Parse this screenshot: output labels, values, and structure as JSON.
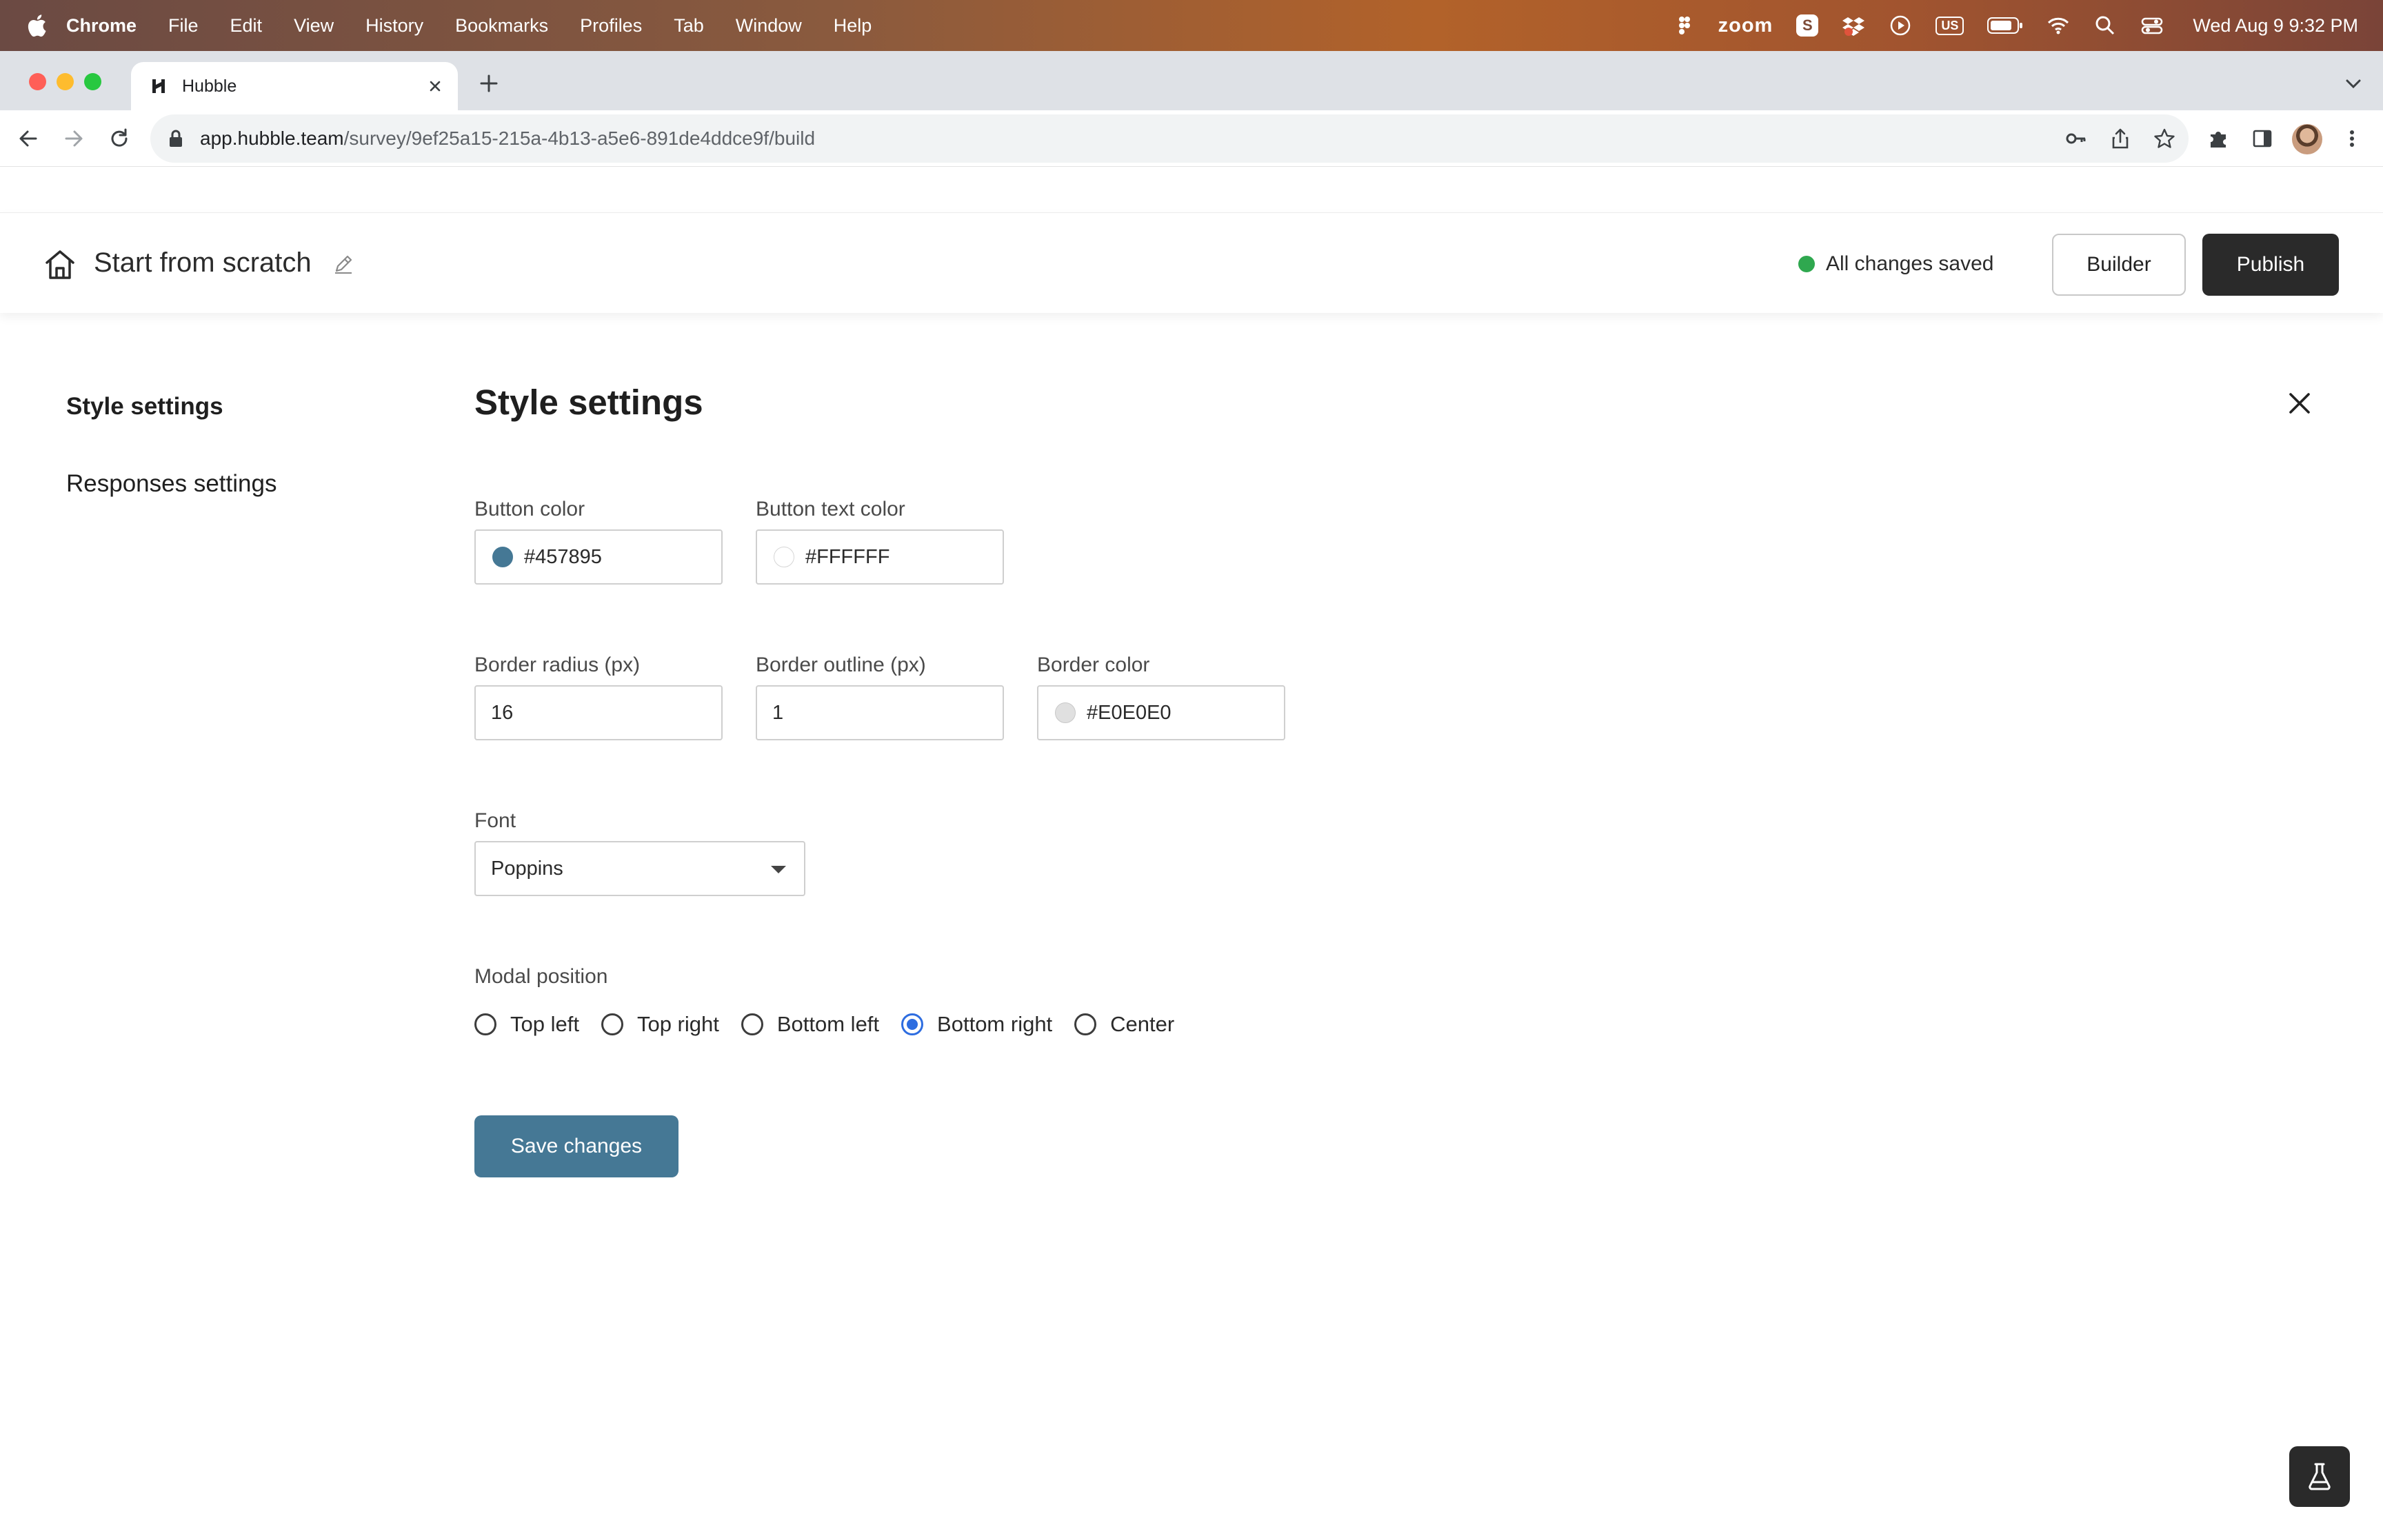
{
  "os_menubar": {
    "app_name": "Chrome",
    "menus": [
      "File",
      "Edit",
      "View",
      "History",
      "Bookmarks",
      "Profiles",
      "Tab",
      "Window",
      "Help"
    ],
    "status": {
      "zoom_label": "zoom",
      "s_badge": "S",
      "keyboard": "US",
      "datetime": "Wed Aug 9  9:32 PM"
    }
  },
  "browser": {
    "tab_title": "Hubble",
    "url_host": "app.hubble.team",
    "url_path": "/survey/9ef25a15-215a-4b13-a5e6-891de4ddce9f/build"
  },
  "header": {
    "title": "Start from scratch",
    "save_status": "All changes saved",
    "builder_label": "Builder",
    "publish_label": "Publish",
    "status_color": "#2fa84f"
  },
  "sidebar": {
    "items": [
      {
        "label": "Style settings",
        "active": true
      },
      {
        "label": "Responses settings",
        "active": false
      }
    ]
  },
  "main": {
    "title": "Style settings",
    "button_color": {
      "label": "Button color",
      "value": "#457895"
    },
    "button_text_color": {
      "label": "Button text color",
      "value": "#FFFFFF"
    },
    "border_radius": {
      "label": "Border radius (px)",
      "value": "16"
    },
    "border_outline": {
      "label": "Border outline (px)",
      "value": "1"
    },
    "border_color": {
      "label": "Border color",
      "value": "#E0E0E0"
    },
    "font": {
      "label": "Font",
      "value": "Poppins"
    },
    "modal_position": {
      "label": "Modal position",
      "options": [
        "Top left",
        "Top right",
        "Bottom left",
        "Bottom right",
        "Center"
      ],
      "selected": "Bottom right"
    },
    "save_label": "Save changes"
  },
  "colors": {
    "accent": "#457895",
    "publish_bg": "#2a2a2a",
    "radio_selected": "#2e6de0"
  },
  "icons": {
    "header": [
      "home-icon",
      "pencil-icon"
    ],
    "close": "close-icon",
    "fab": "flask-icon"
  }
}
